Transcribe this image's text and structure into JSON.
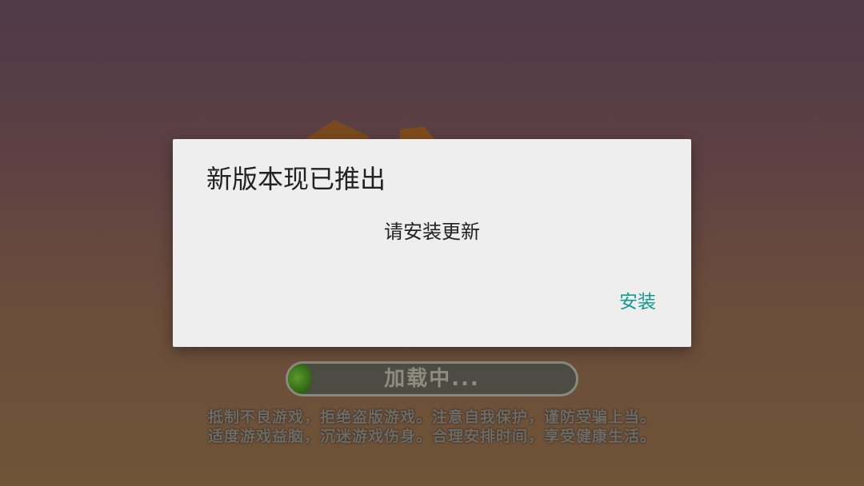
{
  "background": {
    "loading": {
      "label": "加载中...",
      "progress_percent": 5,
      "fill_color": "#3d7a1c"
    },
    "notice_lines": [
      "抵制不良游戏，拒绝盗版游戏。注意自我保护，谨防受骗上当。",
      "适度游戏益脑，沉迷游戏伤身。合理安排时间，享受健康生活。"
    ]
  },
  "dialog": {
    "title": "新版本现已推出",
    "message": "请安装更新",
    "install_button": "安装",
    "accent_color": "#139a8e"
  }
}
